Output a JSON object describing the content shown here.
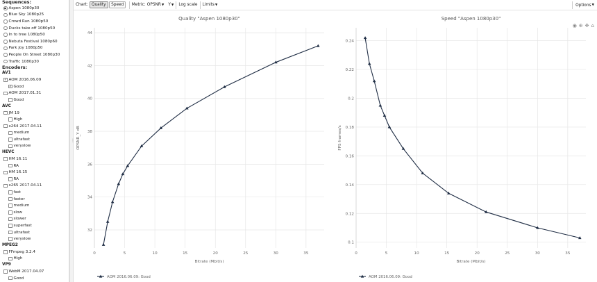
{
  "sidebar": {
    "sequences_title": "Sequences:",
    "sequences": [
      {
        "label": "Aspen 1080p30",
        "selected": true
      },
      {
        "label": "Blue Sky 1080p25",
        "selected": false
      },
      {
        "label": "Crowd Run 1080p50",
        "selected": false
      },
      {
        "label": "Ducks take off 1080p50",
        "selected": false
      },
      {
        "label": "In to tree 1080p50",
        "selected": false
      },
      {
        "label": "Nebuta Festival 1080p60",
        "selected": false
      },
      {
        "label": "Park Joy 1080p50",
        "selected": false
      },
      {
        "label": "People On Street 1080p30",
        "selected": false
      },
      {
        "label": "Traffic 1080p30",
        "selected": false
      }
    ],
    "encoders_title": "Encoders:",
    "groups": [
      {
        "name": "AV1",
        "items": [
          {
            "label": "AOM 2016.06.09",
            "level": 0,
            "checked": true
          },
          {
            "label": "Good",
            "level": 1,
            "checked": true
          },
          {
            "label": "AOM 2017.01.31",
            "level": 0,
            "checked": false
          },
          {
            "label": "Good",
            "level": 1,
            "checked": false
          }
        ]
      },
      {
        "name": "AVC",
        "items": [
          {
            "label": "JM 19",
            "level": 0,
            "checked": false
          },
          {
            "label": "High",
            "level": 1,
            "checked": false
          },
          {
            "label": "x264 2017.04.11",
            "level": 0,
            "checked": false
          },
          {
            "label": "medium",
            "level": 1,
            "checked": false
          },
          {
            "label": "ultrafast",
            "level": 1,
            "checked": false
          },
          {
            "label": "veryslow",
            "level": 1,
            "checked": false
          }
        ]
      },
      {
        "name": "HEVC",
        "items": [
          {
            "label": "HM 16.11",
            "level": 0,
            "checked": false
          },
          {
            "label": "RA",
            "level": 1,
            "checked": false
          },
          {
            "label": "HM 16.15",
            "level": 0,
            "checked": false
          },
          {
            "label": "RA",
            "level": 1,
            "checked": false
          },
          {
            "label": "x265 2017.04.11",
            "level": 0,
            "checked": false
          },
          {
            "label": "fast",
            "level": 1,
            "checked": false
          },
          {
            "label": "faster",
            "level": 1,
            "checked": false
          },
          {
            "label": "medium",
            "level": 1,
            "checked": false
          },
          {
            "label": "slow",
            "level": 1,
            "checked": false
          },
          {
            "label": "slower",
            "level": 1,
            "checked": false
          },
          {
            "label": "superfast",
            "level": 1,
            "checked": false
          },
          {
            "label": "ultrafast",
            "level": 1,
            "checked": false
          },
          {
            "label": "veryslow",
            "level": 1,
            "checked": false
          }
        ]
      },
      {
        "name": "MPEG2",
        "items": [
          {
            "label": "FFmpeg 3.2.4",
            "level": 0,
            "checked": false
          },
          {
            "label": "High",
            "level": 1,
            "checked": false
          }
        ]
      },
      {
        "name": "VP9",
        "items": [
          {
            "label": "WebM 2017.04.07",
            "level": 0,
            "checked": false
          },
          {
            "label": "Good",
            "level": 1,
            "checked": false
          }
        ]
      }
    ]
  },
  "toolbar": {
    "chart_label": "Chart:",
    "quality_button": "Quality",
    "speed_button": "Speed",
    "metric_label": "Metric:",
    "metric_value": "OPSNR",
    "y_value": "Y",
    "log_scale_label": "Log scale",
    "limits_label": "Limits",
    "options_label": "Options"
  },
  "colors": {
    "series": "#1f2d44",
    "grid": "#e6e6e6",
    "axis_text": "#666666"
  },
  "chart_icons": [
    "camera-icon",
    "zoom-in-icon",
    "pan-icon",
    "home-icon"
  ],
  "chart_data": [
    {
      "type": "line",
      "title": "Quality \"Aspen 1080p30\"",
      "xlabel": "Bitrate (Mbit/s)",
      "ylabel": "OPSNR_Y dB",
      "xlim": [
        0,
        38
      ],
      "ylim": [
        30.9,
        44.3
      ],
      "xticks": [
        0,
        5,
        10,
        15,
        20,
        25,
        30,
        35
      ],
      "yticks": [
        32,
        34,
        36,
        38,
        40,
        42,
        44
      ],
      "grid": true,
      "legend_position": "bottom-left",
      "series": [
        {
          "name": "AOM 2016.06.09: Good",
          "x": [
            1.5,
            2.2,
            3.0,
            4.0,
            4.7,
            5.5,
            7.8,
            11.0,
            15.3,
            21.5,
            30.0,
            37.0
          ],
          "y": [
            31.1,
            32.5,
            33.7,
            34.8,
            35.4,
            35.9,
            37.1,
            38.2,
            39.4,
            40.7,
            42.2,
            43.2
          ]
        }
      ]
    },
    {
      "type": "line",
      "title": "Speed \"Aspen 1080p30\"",
      "xlabel": "Bitrate (Mbit/s)",
      "ylabel": "FPS frames/s",
      "xlim": [
        0,
        38
      ],
      "ylim": [
        0.096,
        0.249
      ],
      "xticks": [
        0,
        5,
        10,
        15,
        20,
        25,
        30,
        35
      ],
      "yticks": [
        0.1,
        0.12,
        0.14,
        0.16,
        0.18,
        0.2,
        0.22,
        0.24
      ],
      "grid": true,
      "legend_position": "bottom-left",
      "series": [
        {
          "name": "AOM 2016.06.09: Good",
          "x": [
            1.5,
            2.2,
            3.0,
            4.0,
            4.7,
            5.5,
            7.8,
            11.0,
            15.3,
            21.5,
            30.0,
            37.0
          ],
          "y": [
            0.242,
            0.224,
            0.212,
            0.195,
            0.188,
            0.18,
            0.165,
            0.148,
            0.134,
            0.121,
            0.11,
            0.103
          ]
        }
      ]
    }
  ]
}
